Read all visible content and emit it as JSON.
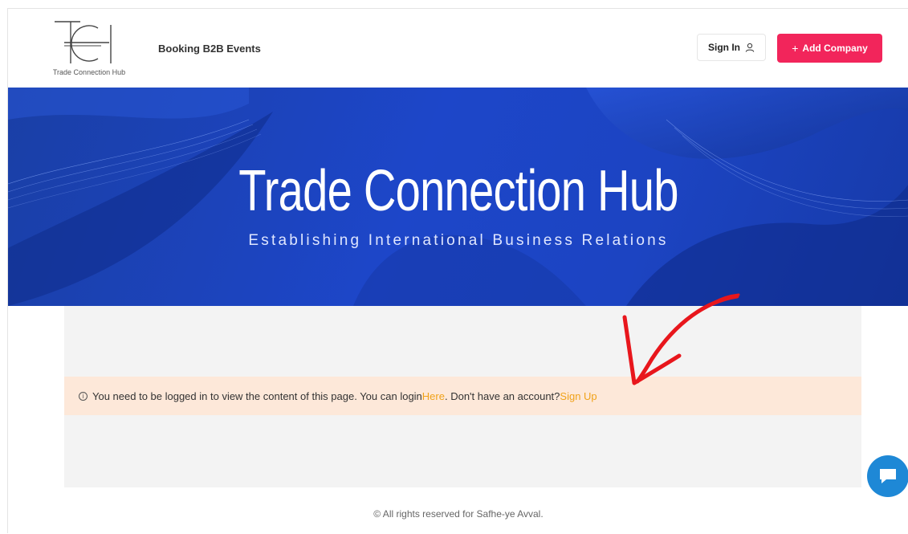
{
  "header": {
    "logo_text": "Trade Connection Hub",
    "nav_link": "Booking B2B Events",
    "signin_label": "Sign In",
    "add_company_label": "Add Company",
    "add_company_plus": "+"
  },
  "hero": {
    "title": "Trade Connection Hub",
    "subtitle": "Establishing International Business Relations"
  },
  "notice": {
    "text_before": "You need to be logged in to view the content of this page. You can login ",
    "login_link": "Here",
    "text_middle": ". Don't have an account? ",
    "signup_link": "Sign Up"
  },
  "footer": {
    "copyright": "© All rights reserved for Safhe-ye Avval."
  },
  "icons": {
    "signin": "user-icon",
    "notice": "info-icon",
    "chat": "chat-icon"
  },
  "colors": {
    "accent": "#f2255b",
    "hero_blue": "#1d46c9",
    "notice_bg": "#fde8d9",
    "link": "#f0a21a",
    "chat": "#1e88d6",
    "arrow": "#e8161c"
  }
}
